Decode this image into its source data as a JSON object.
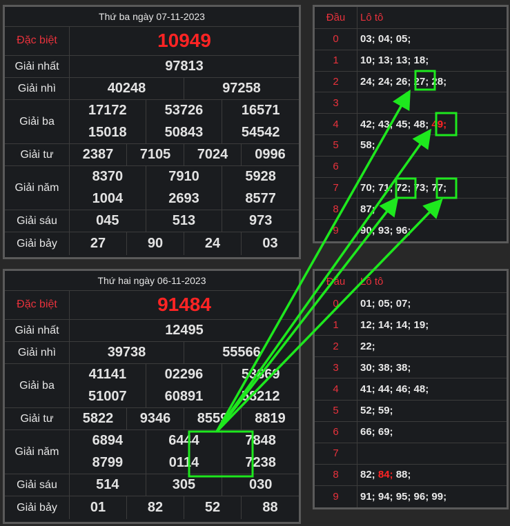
{
  "top": {
    "date": "Thứ ba ngày 07-11-2023",
    "rows": [
      {
        "label": "Đặc biệt",
        "red": true,
        "values": [
          "10949"
        ]
      },
      {
        "label": "Giải nhất",
        "values": [
          "97813"
        ]
      },
      {
        "label": "Giải nhì",
        "values": [
          "40248",
          "97258"
        ]
      },
      {
        "label": "Giải ba",
        "values": [
          "17172",
          "53726",
          "16571",
          "15018",
          "50843",
          "54542"
        ]
      },
      {
        "label": "Giải tư",
        "values": [
          "2387",
          "7105",
          "7024",
          "0996"
        ]
      },
      {
        "label": "Giải năm",
        "values": [
          "8370",
          "7910",
          "5928",
          "1004",
          "2693",
          "8577"
        ]
      },
      {
        "label": "Giải sáu",
        "values": [
          "045",
          "513",
          "973"
        ]
      },
      {
        "label": "Giải bảy",
        "values": [
          "27",
          "90",
          "24",
          "03"
        ]
      }
    ]
  },
  "bottom": {
    "date": "Thứ hai ngày 06-11-2023",
    "rows": [
      {
        "label": "Đặc biệt",
        "red": true,
        "values": [
          "91484"
        ]
      },
      {
        "label": "Giải nhất",
        "values": [
          "12495"
        ]
      },
      {
        "label": "Giải nhì",
        "values": [
          "39738",
          "55566"
        ]
      },
      {
        "label": "Giải ba",
        "values": [
          "41141",
          "02296",
          "53869",
          "51007",
          "60891",
          "58212"
        ]
      },
      {
        "label": "Giải tư",
        "values": [
          "5822",
          "9346",
          "8559",
          "8819"
        ]
      },
      {
        "label": "Giải năm",
        "values": [
          "6894",
          "6444",
          "7848",
          "8799",
          "0114",
          "7238"
        ]
      },
      {
        "label": "Giải sáu",
        "values": [
          "514",
          "305",
          "030"
        ]
      },
      {
        "label": "Giải bảy",
        "values": [
          "01",
          "82",
          "52",
          "88"
        ]
      }
    ]
  },
  "loto_top": {
    "head_label": "Đầu",
    "tail_label": "Lô tô",
    "rows": [
      {
        "head": "0",
        "tails": "03; 04; 05;"
      },
      {
        "head": "1",
        "tails": "10; 13; 13; 18;"
      },
      {
        "head": "2",
        "tails": "24; 24; 26; 27; 28;"
      },
      {
        "head": "3",
        "tails": ""
      },
      {
        "head": "4",
        "tails": "42; 43; 45; 48; ",
        "highlight": "49;"
      },
      {
        "head": "5",
        "tails": "58;"
      },
      {
        "head": "6",
        "tails": ""
      },
      {
        "head": "7",
        "tails": "70; 71; 72; 73; 77;"
      },
      {
        "head": "8",
        "tails": "87;"
      },
      {
        "head": "9",
        "tails": "90; 93; 96;"
      }
    ]
  },
  "loto_bottom": {
    "head_label": "Đầu",
    "tail_label": "Lô tô",
    "rows": [
      {
        "head": "0",
        "tails": "01; 05; 07;"
      },
      {
        "head": "1",
        "tails": "12; 14; 14; 19;"
      },
      {
        "head": "2",
        "tails": "22;"
      },
      {
        "head": "3",
        "tails": "30; 38; 38;"
      },
      {
        "head": "4",
        "tails": "41; 44; 46; 48;"
      },
      {
        "head": "5",
        "tails": "52; 59;"
      },
      {
        "head": "6",
        "tails": "66; 69;"
      },
      {
        "head": "7",
        "tails": ""
      },
      {
        "head": "8",
        "tails": "82; ",
        "highlight": "84;",
        "after": " 88;"
      },
      {
        "head": "9",
        "tails": "91; 94; 95; 96; 99;"
      }
    ]
  },
  "colors": {
    "annotation": "#1ee81e",
    "special": "#ff2424",
    "heading": "#e8323c"
  }
}
